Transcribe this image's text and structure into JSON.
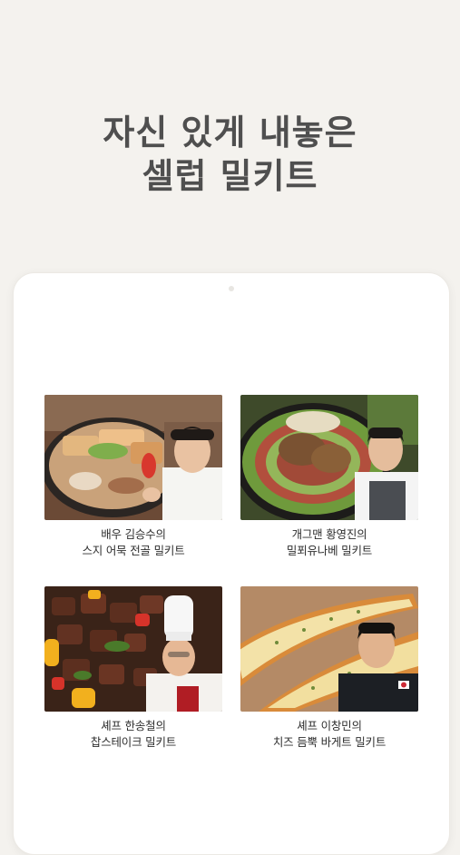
{
  "headline": {
    "line1": "자신 있게 내놓은",
    "line2": "셀럽 밀키트"
  },
  "products": [
    {
      "celebrity": "배우 김승수의",
      "product": "스지 어묵 전골 밀키트"
    },
    {
      "celebrity": "개그맨 황영진의",
      "product": "밀푀유나베 밀키트"
    },
    {
      "celebrity": "셰프 한송철의",
      "product": "찹스테이크 밀키트"
    },
    {
      "celebrity": "셰프 이창민의",
      "product": "치즈 듬뿍 바게트 밀키트"
    }
  ],
  "colors": {
    "background": "#f4f2ee",
    "headline": "#4f4f4f",
    "tablet": "#ffffff"
  }
}
